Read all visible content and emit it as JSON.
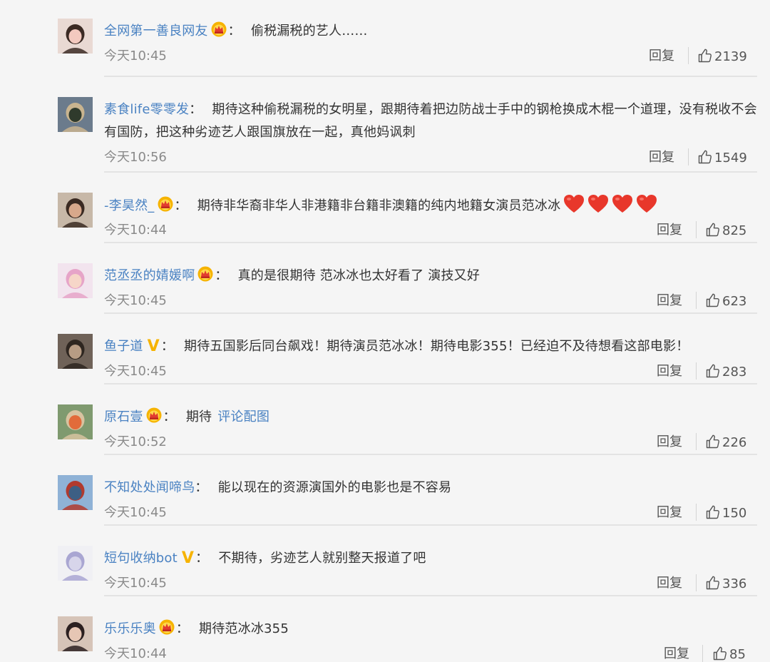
{
  "comments": [
    {
      "username": "全网第一善良网友",
      "badge": "crown",
      "text": "偷税漏税的艺人……",
      "time": "今天10:45",
      "reply": "回复",
      "likes": "2139"
    },
    {
      "username": "素食life零零发",
      "badge": "none",
      "text": "期待这种偷税漏税的女明星，跟期待着把边防战士手中的钢枪换成木棍一个道理，没有税收不会有国防，把这种劣迹艺人跟国旗放在一起，真他妈讽刺",
      "time": "今天10:56",
      "reply": "回复",
      "likes": "1549"
    },
    {
      "username": "-李昊然_",
      "badge": "crown",
      "text": "期待非华裔非华人非港籍非台籍非澳籍的纯内地籍女演员范冰冰",
      "hearts": 4,
      "time": "今天10:44",
      "reply": "回复",
      "likes": "825"
    },
    {
      "username": "范丞丞的婧媛啊",
      "badge": "crown",
      "text": "真的是很期待 范冰冰也太好看了 演技又好",
      "time": "今天10:45",
      "reply": "回复",
      "likes": "623"
    },
    {
      "username": "鱼子道",
      "badge": "V",
      "text": "期待五国影后同台飙戏！期待演员范冰冰！期待电影355！已经迫不及待想看这部电影！",
      "time": "今天10:45",
      "reply": "回复",
      "likes": "283"
    },
    {
      "username": "原石壹",
      "badge": "crown",
      "text": "期待",
      "link": "评论配图",
      "time": "今天10:52",
      "reply": "回复",
      "likes": "226"
    },
    {
      "username": "不知处处闻啼鸟",
      "badge": "none",
      "text": "能以现在的资源演国外的电影也是不容易",
      "time": "今天10:45",
      "reply": "回复",
      "likes": "150"
    },
    {
      "username": "短句收纳bot",
      "badge": "V",
      "text": "不期待，劣迹艺人就别整天报道了吧",
      "time": "今天10:45",
      "reply": "回复",
      "likes": "336"
    },
    {
      "username": "乐乐乐奥",
      "badge": "crown",
      "text": "期待范冰冰355",
      "time": "今天10:44",
      "reply": "回复",
      "likes": "85"
    }
  ],
  "colors": {
    "username": "#4a82c2",
    "text": "#333333",
    "time": "#8a8a8a",
    "crown": "#f6b300",
    "heart": "#e8372b"
  }
}
